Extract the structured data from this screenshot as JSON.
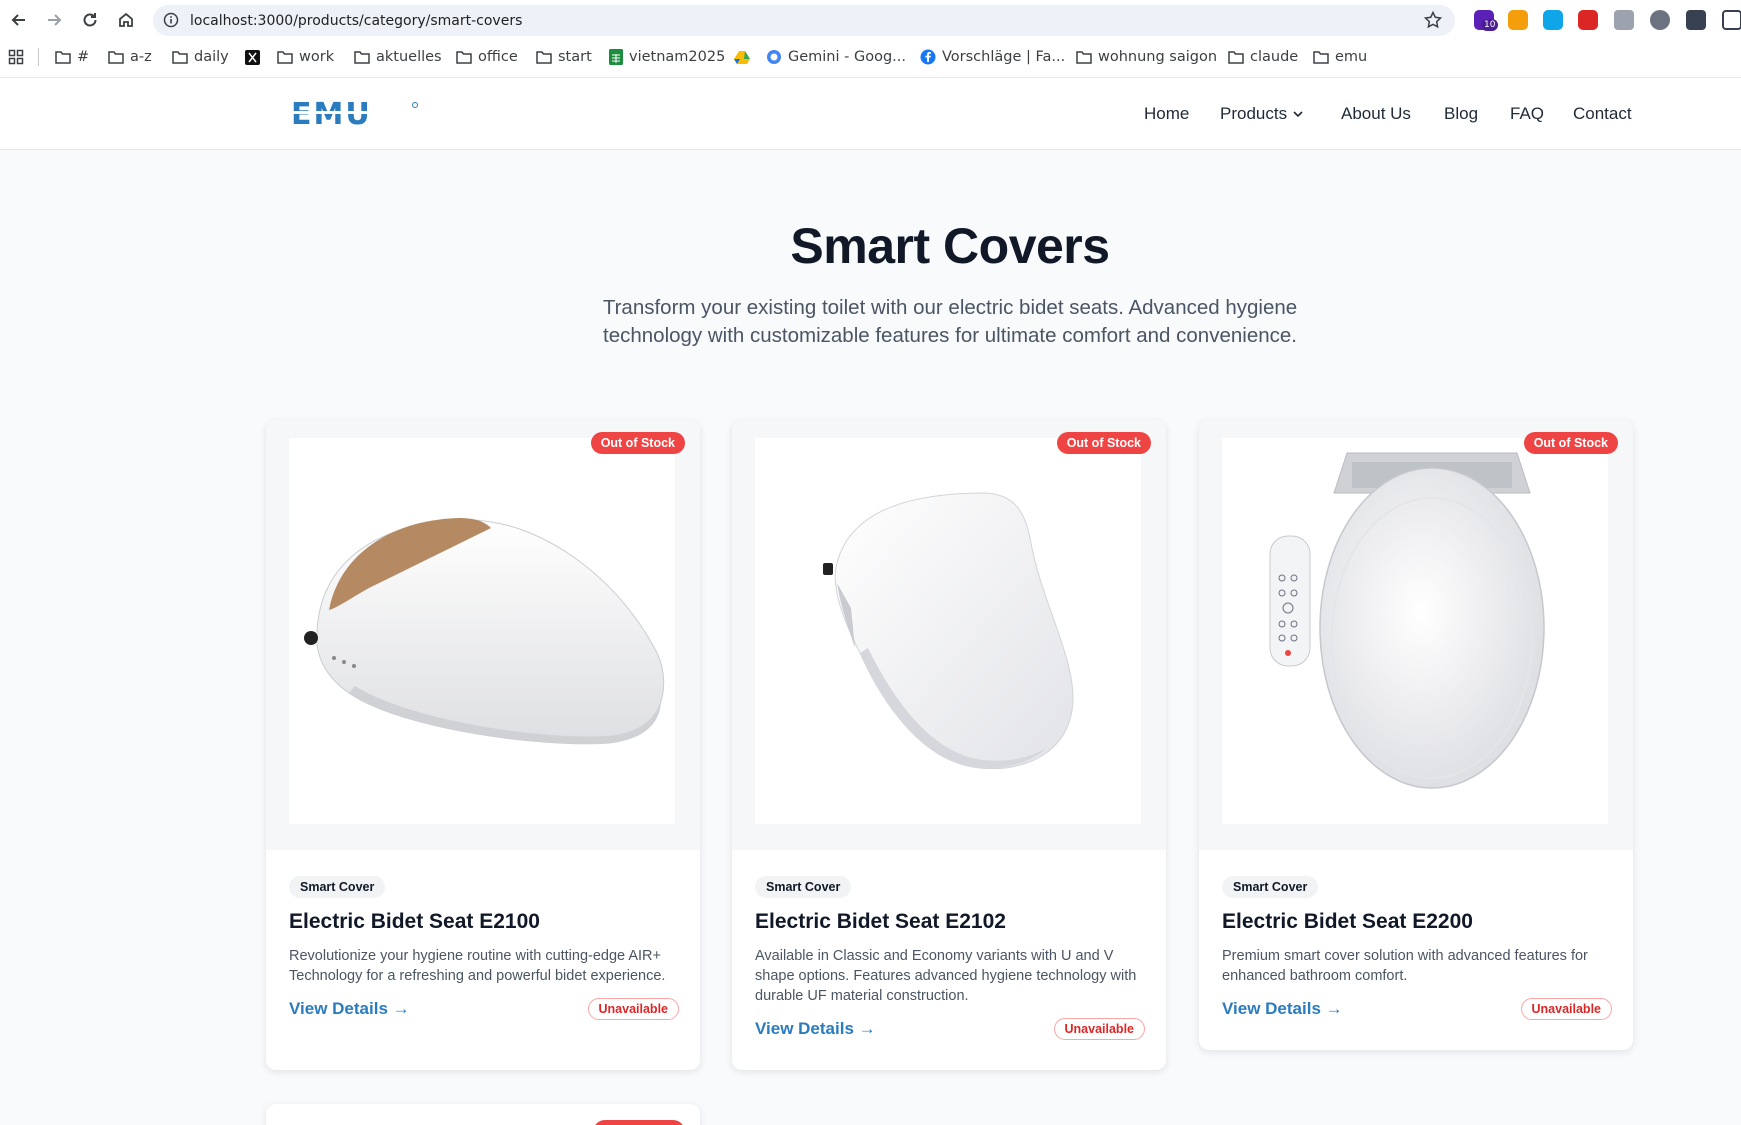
{
  "browser": {
    "url": "localhost:3000/products/category/smart-covers",
    "extensions": [
      {
        "icon": "home-badge-icon",
        "badge": "10",
        "color": "#5b21b6"
      },
      {
        "icon": "elephant-icon",
        "color": "#f59e0b"
      },
      {
        "icon": "square-extension-icon",
        "color": "#0ea5e9"
      },
      {
        "icon": "red-s-extension-icon",
        "color": "#dc2626"
      },
      {
        "icon": "camera-icon",
        "color": "#9ca3af"
      },
      {
        "icon": "circle-extension-icon",
        "color": "#6b7280"
      },
      {
        "icon": "v-extension-icon",
        "color": "#374151"
      },
      {
        "icon": "s-extension-icon",
        "color": "#374151"
      }
    ],
    "bookmarks": [
      {
        "label": "#",
        "icon": "folder-icon"
      },
      {
        "label": "a-z",
        "icon": "folder-icon"
      },
      {
        "label": "daily",
        "icon": "folder-icon"
      },
      {
        "label": "",
        "icon": "x-logo-icon"
      },
      {
        "label": "work",
        "icon": "folder-icon"
      },
      {
        "label": "aktuelles",
        "icon": "folder-icon"
      },
      {
        "label": "office",
        "icon": "folder-icon"
      },
      {
        "label": "start",
        "icon": "folder-icon"
      },
      {
        "label": "vietnam2025",
        "icon": "sheets-icon"
      },
      {
        "label": "",
        "icon": "drive-icon"
      },
      {
        "label": "Gemini - Goog...",
        "icon": "gemini-icon"
      },
      {
        "label": "Vorschläge | Fa...",
        "icon": "facebook-icon"
      },
      {
        "label": "wohnung saigon",
        "icon": "folder-icon"
      },
      {
        "label": "claude",
        "icon": "folder-icon"
      },
      {
        "label": "emu",
        "icon": "folder-icon"
      }
    ]
  },
  "site": {
    "logo_text": "EMU",
    "nav": [
      {
        "label": "Home"
      },
      {
        "label": "Products",
        "has_dropdown": true
      },
      {
        "label": "About Us"
      },
      {
        "label": "Blog"
      },
      {
        "label": "FAQ"
      },
      {
        "label": "Contact"
      }
    ],
    "brand_color": "#2b7bbf"
  },
  "hero": {
    "title": "Smart Covers",
    "description": "Transform your existing toilet with our electric bidet seats. Advanced hygiene technology with customizable features for ultimate comfort and convenience."
  },
  "products": [
    {
      "stock_badge": "Out of Stock",
      "category": "Smart Cover",
      "name": "Electric Bidet Seat E2100",
      "description": "Revolutionize your hygiene routine with cutting-edge AIR+ Technology for a refreshing and powerful bidet experience.",
      "link": "View Details →",
      "availability": "Unavailable"
    },
    {
      "stock_badge": "Out of Stock",
      "category": "Smart Cover",
      "name": "Electric Bidet Seat E2102",
      "description": "Available in Classic and Economy variants with U and V shape options. Features advanced hygiene technology with durable UF material construction.",
      "link": "View Details →",
      "availability": "Unavailable"
    },
    {
      "stock_badge": "Out of Stock",
      "category": "Smart Cover",
      "name": "Electric Bidet Seat E2200",
      "description": "Premium smart cover solution with advanced features for enhanced bathroom comfort.",
      "link": "View Details →",
      "availability": "Unavailable"
    }
  ],
  "colors": {
    "out_of_stock": "#ef4444",
    "unavailable": "#dc2626"
  }
}
